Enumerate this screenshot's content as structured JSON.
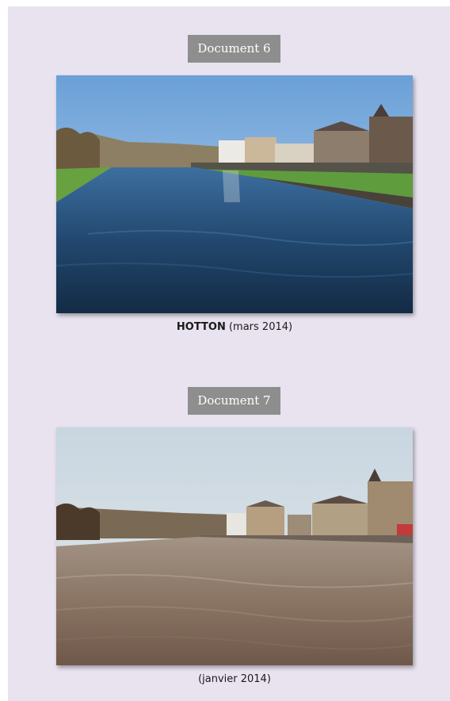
{
  "documents": [
    {
      "label": "Document 6",
      "photo": {
        "subject": "river-calm-hotton"
      },
      "caption": {
        "place": "HOTTON",
        "date": "(mars 2014)"
      }
    },
    {
      "label": "Document 7",
      "photo": {
        "subject": "river-flood-hotton"
      },
      "caption": {
        "place": "",
        "date": "(janvier 2014)"
      }
    }
  ],
  "colors": {
    "panel": "#e9e3f0",
    "label_bg": "#8e8e8e",
    "label_text": "#ffffff"
  }
}
